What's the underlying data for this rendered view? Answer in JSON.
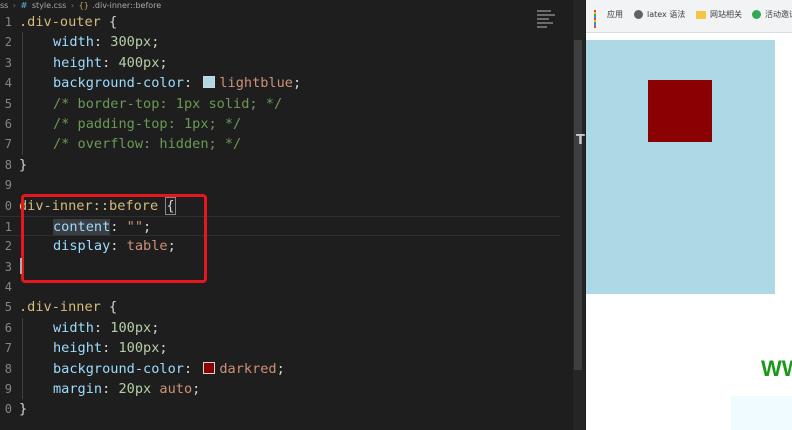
{
  "breadcrumb": {
    "file_prefix": "ss",
    "file_icon": "#",
    "file_name": "style.css",
    "symbol_icon": "{}",
    "symbol_name": ".div-inner::before"
  },
  "editor": {
    "lines": [
      {
        "n": "1",
        "tokens": [
          {
            "c": "sel",
            "t": ".div-outer"
          },
          {
            "c": "punc",
            "t": " {"
          }
        ]
      },
      {
        "n": "2",
        "ind": true,
        "tokens": [
          {
            "c": "prop",
            "t": "width"
          },
          {
            "c": "punc",
            "t": ": "
          },
          {
            "c": "num",
            "t": "300px"
          },
          {
            "c": "punc",
            "t": ";"
          }
        ]
      },
      {
        "n": "3",
        "ind": true,
        "tokens": [
          {
            "c": "prop",
            "t": "height"
          },
          {
            "c": "punc",
            "t": ": "
          },
          {
            "c": "num",
            "t": "400px"
          },
          {
            "c": "punc",
            "t": ";"
          }
        ]
      },
      {
        "n": "4",
        "ind": true,
        "tokens": [
          {
            "c": "prop",
            "t": "background-color"
          },
          {
            "c": "punc",
            "t": ": "
          },
          {
            "c": "swatch",
            "color": "#add8e6"
          },
          {
            "c": "val",
            "t": "lightblue"
          },
          {
            "c": "punc",
            "t": ";"
          }
        ]
      },
      {
        "n": "5",
        "ind": true,
        "tokens": [
          {
            "c": "cmt",
            "t": "/* border-top: 1px solid; */"
          }
        ]
      },
      {
        "n": "6",
        "ind": true,
        "tokens": [
          {
            "c": "cmt",
            "t": "/* padding-top: 1px; */"
          }
        ]
      },
      {
        "n": "7",
        "ind": true,
        "tokens": [
          {
            "c": "cmt",
            "t": "/* overflow: hidden; */"
          }
        ]
      },
      {
        "n": "8",
        "tokens": [
          {
            "c": "brace",
            "t": "}"
          }
        ]
      },
      {
        "n": "9",
        "tokens": []
      },
      {
        "n": "0",
        "tokens": [
          {
            "c": "sel",
            "t": "div-inner::before"
          },
          {
            "c": "punc",
            "t": " "
          },
          {
            "c": "brace match",
            "t": "{"
          }
        ]
      },
      {
        "n": "1",
        "ind": true,
        "current": true,
        "tokens": [
          {
            "c": "prop hl",
            "t": "content"
          },
          {
            "c": "punc",
            "t": ": "
          },
          {
            "c": "str",
            "t": "\"\""
          },
          {
            "c": "punc",
            "t": ";"
          }
        ]
      },
      {
        "n": "2",
        "ind": true,
        "tokens": [
          {
            "c": "prop",
            "t": "display"
          },
          {
            "c": "punc",
            "t": ": "
          },
          {
            "c": "val",
            "t": "table"
          },
          {
            "c": "punc",
            "t": ";"
          }
        ]
      },
      {
        "n": "3",
        "tokens": [
          {
            "c": "brace",
            "t": ""
          }
        ]
      },
      {
        "n": "4",
        "tokens": []
      },
      {
        "n": "5",
        "tokens": [
          {
            "c": "sel",
            "t": ".div-inner"
          },
          {
            "c": "punc",
            "t": " {"
          }
        ]
      },
      {
        "n": "6",
        "ind": true,
        "tokens": [
          {
            "c": "prop",
            "t": "width"
          },
          {
            "c": "punc",
            "t": ": "
          },
          {
            "c": "num",
            "t": "100px"
          },
          {
            "c": "punc",
            "t": ";"
          }
        ]
      },
      {
        "n": "7",
        "ind": true,
        "tokens": [
          {
            "c": "prop",
            "t": "height"
          },
          {
            "c": "punc",
            "t": ": "
          },
          {
            "c": "num",
            "t": "100px"
          },
          {
            "c": "punc",
            "t": ";"
          }
        ]
      },
      {
        "n": "8",
        "ind": true,
        "tokens": [
          {
            "c": "prop",
            "t": "background-color"
          },
          {
            "c": "punc",
            "t": ": "
          },
          {
            "c": "swatch",
            "color": "#8b0000"
          },
          {
            "c": "val",
            "t": "darkred"
          },
          {
            "c": "punc",
            "t": ";"
          }
        ]
      },
      {
        "n": "9",
        "ind": true,
        "tokens": [
          {
            "c": "prop",
            "t": "margin"
          },
          {
            "c": "punc",
            "t": ": "
          },
          {
            "c": "num",
            "t": "20px"
          },
          {
            "c": "punc",
            "t": " "
          },
          {
            "c": "val",
            "t": "auto"
          },
          {
            "c": "punc",
            "t": ";"
          }
        ]
      },
      {
        "n": "0",
        "tokens": [
          {
            "c": "brace",
            "t": "}"
          }
        ]
      }
    ],
    "scroll_marker": "T",
    "highlight_color": "#e5161c"
  },
  "browser": {
    "bookmarks": [
      {
        "label": "应用",
        "icon": "apps-grid-icon"
      },
      {
        "label": "latex 语法",
        "icon": "globe-icon"
      },
      {
        "label": "网站相关",
        "icon": "folder-icon"
      },
      {
        "label": "活动邀请",
        "icon": "site-favicon-icon"
      }
    ],
    "outer_color": "#add8e6",
    "inner_color": "#8b0000",
    "partial_text": "WW"
  }
}
